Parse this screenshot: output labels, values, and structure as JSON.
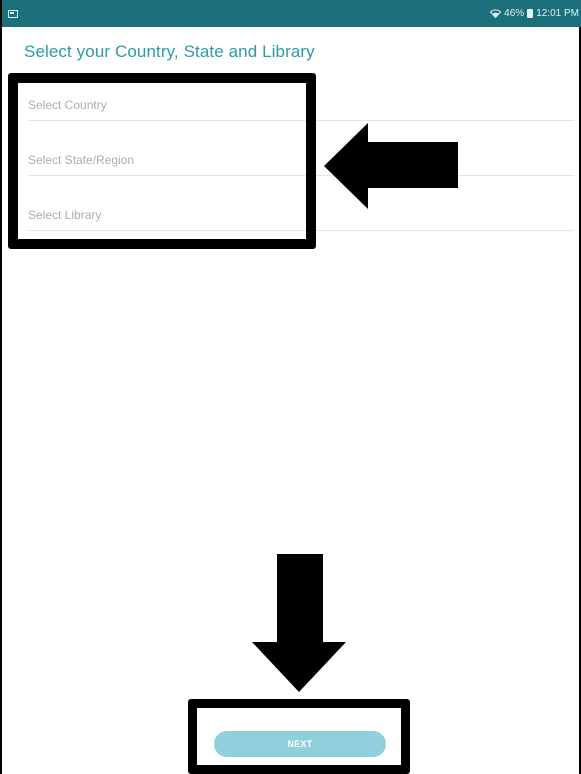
{
  "status_bar": {
    "left_icon": "gallery-icon",
    "wifi_icon": "wifi-icon",
    "battery_percent": "46%",
    "battery_icon": "battery-icon",
    "time": "12:01 PM",
    "background_color": "#1b6f7a"
  },
  "page": {
    "title": "Select your Country, State and Library",
    "title_color": "#2e9aa8"
  },
  "form": {
    "country_placeholder": "Select Country",
    "state_placeholder": "Select State/Region",
    "library_placeholder": "Select Library"
  },
  "footer": {
    "next_label": "NEXT",
    "next_color": "#8fd0dc"
  },
  "annotations": {
    "arrow_left_icon": "arrow-left-icon",
    "arrow_down_icon": "arrow-down-icon"
  }
}
